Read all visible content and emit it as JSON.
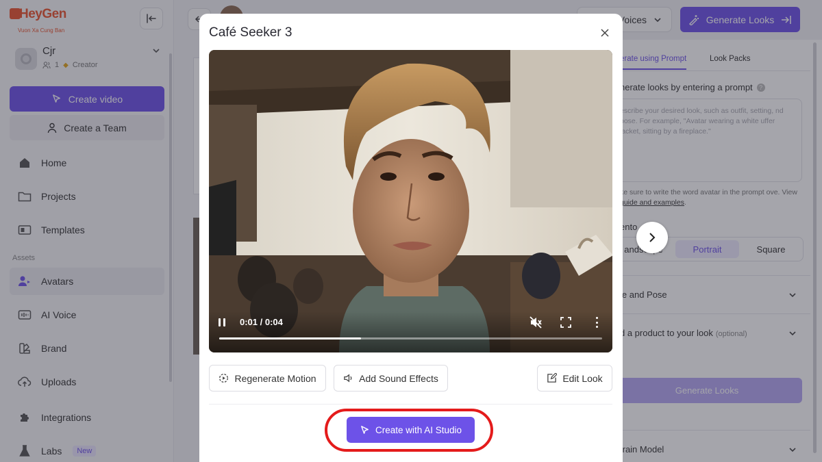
{
  "brand": {
    "logo_text": "HeyGen",
    "watermark": "Vuon Xa Cung Ban",
    "accent_color": "#6d52e8",
    "highlight_color": "#e41b1b"
  },
  "sidebar": {
    "account": {
      "name": "Cjr",
      "members": "1",
      "plan": "Creator"
    },
    "create_video": "Create video",
    "create_team": "Create a Team",
    "nav": [
      {
        "label": "Home",
        "icon": "home-icon"
      },
      {
        "label": "Projects",
        "icon": "folder-icon"
      },
      {
        "label": "Templates",
        "icon": "templates-icon"
      }
    ],
    "assets_label": "Assets",
    "assets": [
      {
        "label": "Avatars",
        "icon": "avatars-icon"
      },
      {
        "label": "AI Voice",
        "icon": "ai-voice-icon"
      },
      {
        "label": "Brand",
        "icon": "brand-icon"
      },
      {
        "label": "Uploads",
        "icon": "upload-icon"
      },
      {
        "label": "Integrations",
        "icon": "puzzle-icon"
      },
      {
        "label": "Labs",
        "icon": "flask-icon",
        "badge": "New"
      }
    ]
  },
  "header": {
    "voices_label": "Voices",
    "generate_looks": "Generate Looks"
  },
  "right_panel": {
    "tabs": [
      "erate using Prompt",
      "Look Packs"
    ],
    "heading": "nerate looks by entering a prompt",
    "prompt_placeholder": "escribe your desired look, such as outfit, setting, nd pose. For example, \"Avatar wearing a white uffer jacket, sitting by a fireplace.\"",
    "hint_text": "ke sure to write the word avatar in the prompt ove. View",
    "hint_link": "guide and examples",
    "orientation_label": "ento",
    "orientation_options": [
      "andscape",
      "Portrait",
      "Square"
    ],
    "orientation_selected": "Portrait",
    "accordion_style": "le and Pose",
    "accordion_product": "d a product to your look",
    "accordion_product_note": "(optional)",
    "generate_button": "Generate Looks",
    "accordion_model": "train Model"
  },
  "modal": {
    "title": "Café Seeker 3",
    "video": {
      "current_time": "0:01",
      "duration": "0:04",
      "time_display": "0:01 / 0:04",
      "progress_fraction": 0.37,
      "muted": true
    },
    "actions": {
      "regenerate": "Regenerate Motion",
      "sound": "Add Sound Effects",
      "edit": "Edit Look"
    },
    "primary_cta": "Create with AI Studio"
  }
}
